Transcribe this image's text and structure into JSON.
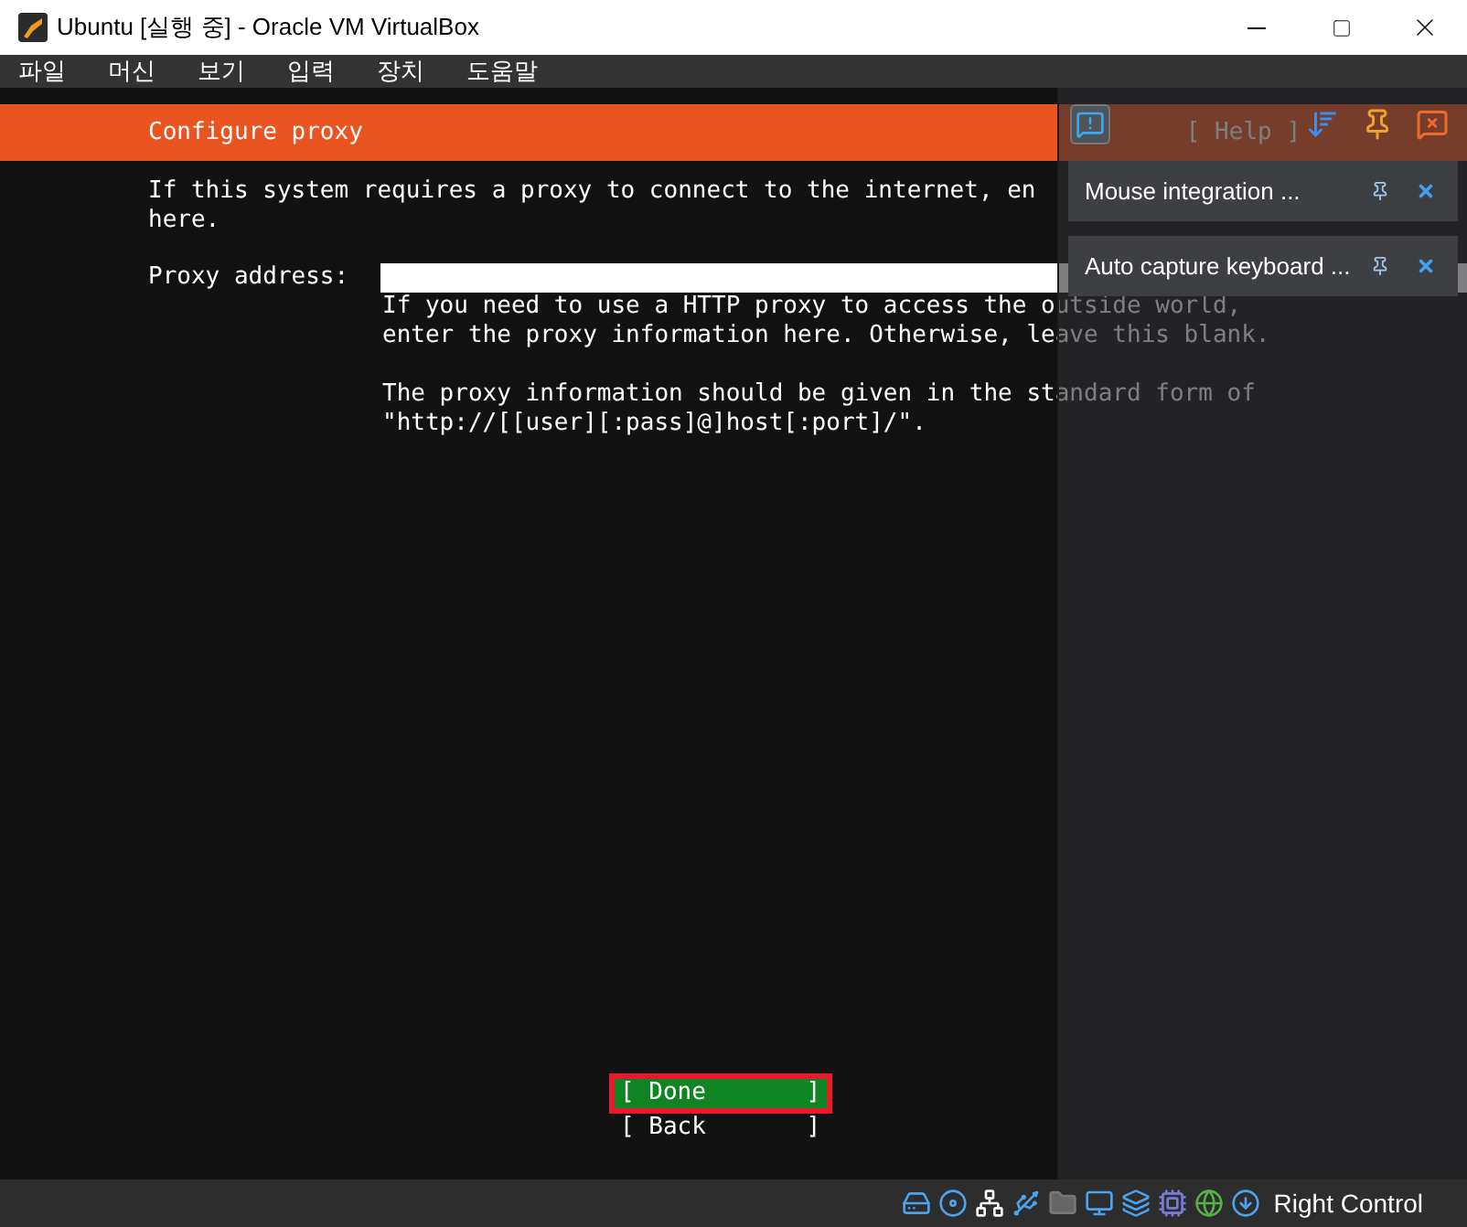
{
  "window": {
    "title": "Ubuntu [실행 중] - Oracle VM VirtualBox"
  },
  "menu": [
    "파일",
    "머신",
    "보기",
    "입력",
    "장치",
    "도움말"
  ],
  "installer": {
    "header": "Configure proxy",
    "help": "[ Help ]",
    "intro": [
      "If this system requires a proxy to connect to the internet, en",
      "here."
    ],
    "field": {
      "label": "Proxy address:"
    },
    "hint": [
      [
        "If you need to use a HTTP proxy to access the outside world,",
        "enter the proxy information here. Otherwise, leave this blank."
      ],
      [
        "The proxy information should be given in the standard form of",
        "\"http://[[user][:pass]@]host[:port]/\"."
      ]
    ],
    "buttons": [
      {
        "label": "[ Done       ]",
        "selected": true
      },
      {
        "label": "[ Back       ]",
        "selected": false
      }
    ]
  },
  "notifications": [
    {
      "text": "Mouse integration ..."
    },
    {
      "text": "Auto capture keyboard ..."
    }
  ],
  "status_bar": {
    "host_key": "Right Control"
  }
}
